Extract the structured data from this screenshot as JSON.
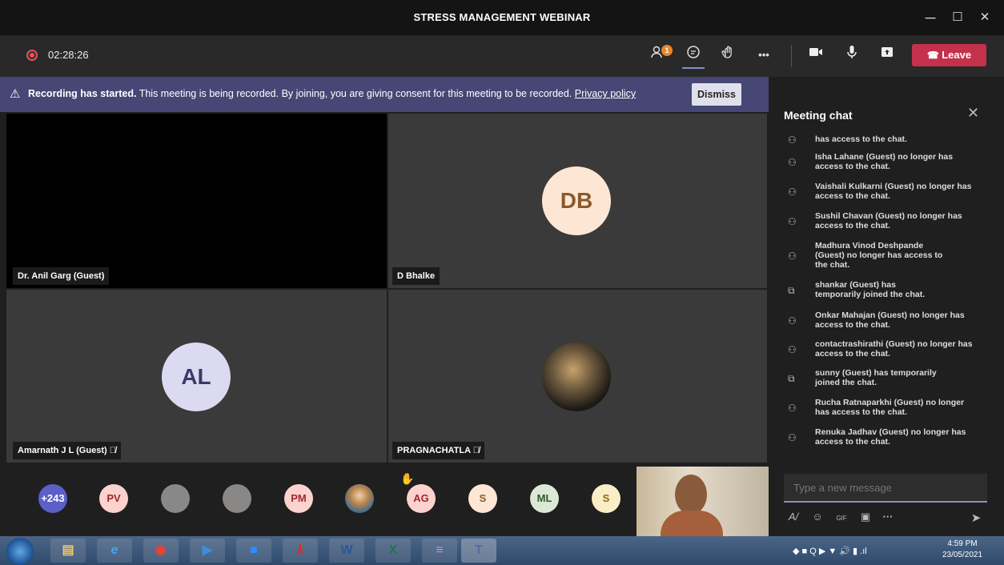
{
  "window": {
    "title": "STRESS MANAGEMENT WEBINAR",
    "minimize": "─",
    "maximize": "☐",
    "close": "✕"
  },
  "toolbar": {
    "timer": "02:28:26",
    "participants_badge": "1",
    "more": "•••",
    "leave_label": "Leave"
  },
  "banner": {
    "bold": "Recording has started.",
    "text": " This meeting is being recorded. By joining, you are giving consent for this meeting to be recorded. ",
    "link": "Privacy policy",
    "dismiss": "Dismiss"
  },
  "tiles": [
    {
      "name": "Dr. Anil Garg (Guest)",
      "initials": ""
    },
    {
      "name": "D Bhalke",
      "initials": "DB"
    },
    {
      "name": "Amarnath J L (Guest)",
      "initials": "AL"
    },
    {
      "name": "PRAGNACHATLA",
      "initials": ""
    }
  ],
  "strip": {
    "overflow": "+243",
    "avatars": [
      "PV",
      "",
      "",
      "PM",
      "",
      "AG",
      "S",
      "ML",
      "S"
    ]
  },
  "chat": {
    "title": "Meeting chat",
    "messages": [
      {
        "text": "has access to the chat.",
        "type": "left"
      },
      {
        "text": "Isha Lahane (Guest) no longer has access to the chat.",
        "type": "left"
      },
      {
        "text": "Vaishali Kulkarni (Guest) no longer has access to the chat.",
        "type": "left"
      },
      {
        "text": "Sushil Chavan (Guest) no longer has access to the chat.",
        "type": "left"
      },
      {
        "text": "Madhura Vinod Deshpande (Guest) no longer has access to the chat.",
        "type": "left"
      },
      {
        "text": "shankar (Guest) has temporarily joined the chat.",
        "type": "joined"
      },
      {
        "text": "Onkar Mahajan (Guest) no longer has access to the chat.",
        "type": "left"
      },
      {
        "text": "contactrashirathi (Guest) no longer has access to the chat.",
        "type": "left"
      },
      {
        "text": "sunny (Guest) has temporarily joined the chat.",
        "type": "joined"
      },
      {
        "text": "Rucha Ratnaparkhi (Guest) no longer has access to the chat.",
        "type": "left"
      },
      {
        "text": "Renuka Jadhav (Guest) no longer has access to the chat.",
        "type": "left"
      }
    ],
    "placeholder": "Type a new message",
    "more": "···",
    "gif": "GIF"
  },
  "taskbar": {
    "time": "4:59 PM",
    "date": "23/05/2021"
  },
  "colors": {
    "accent": "#464775",
    "leave": "#c4314b",
    "underline": "#8b8cc7"
  }
}
